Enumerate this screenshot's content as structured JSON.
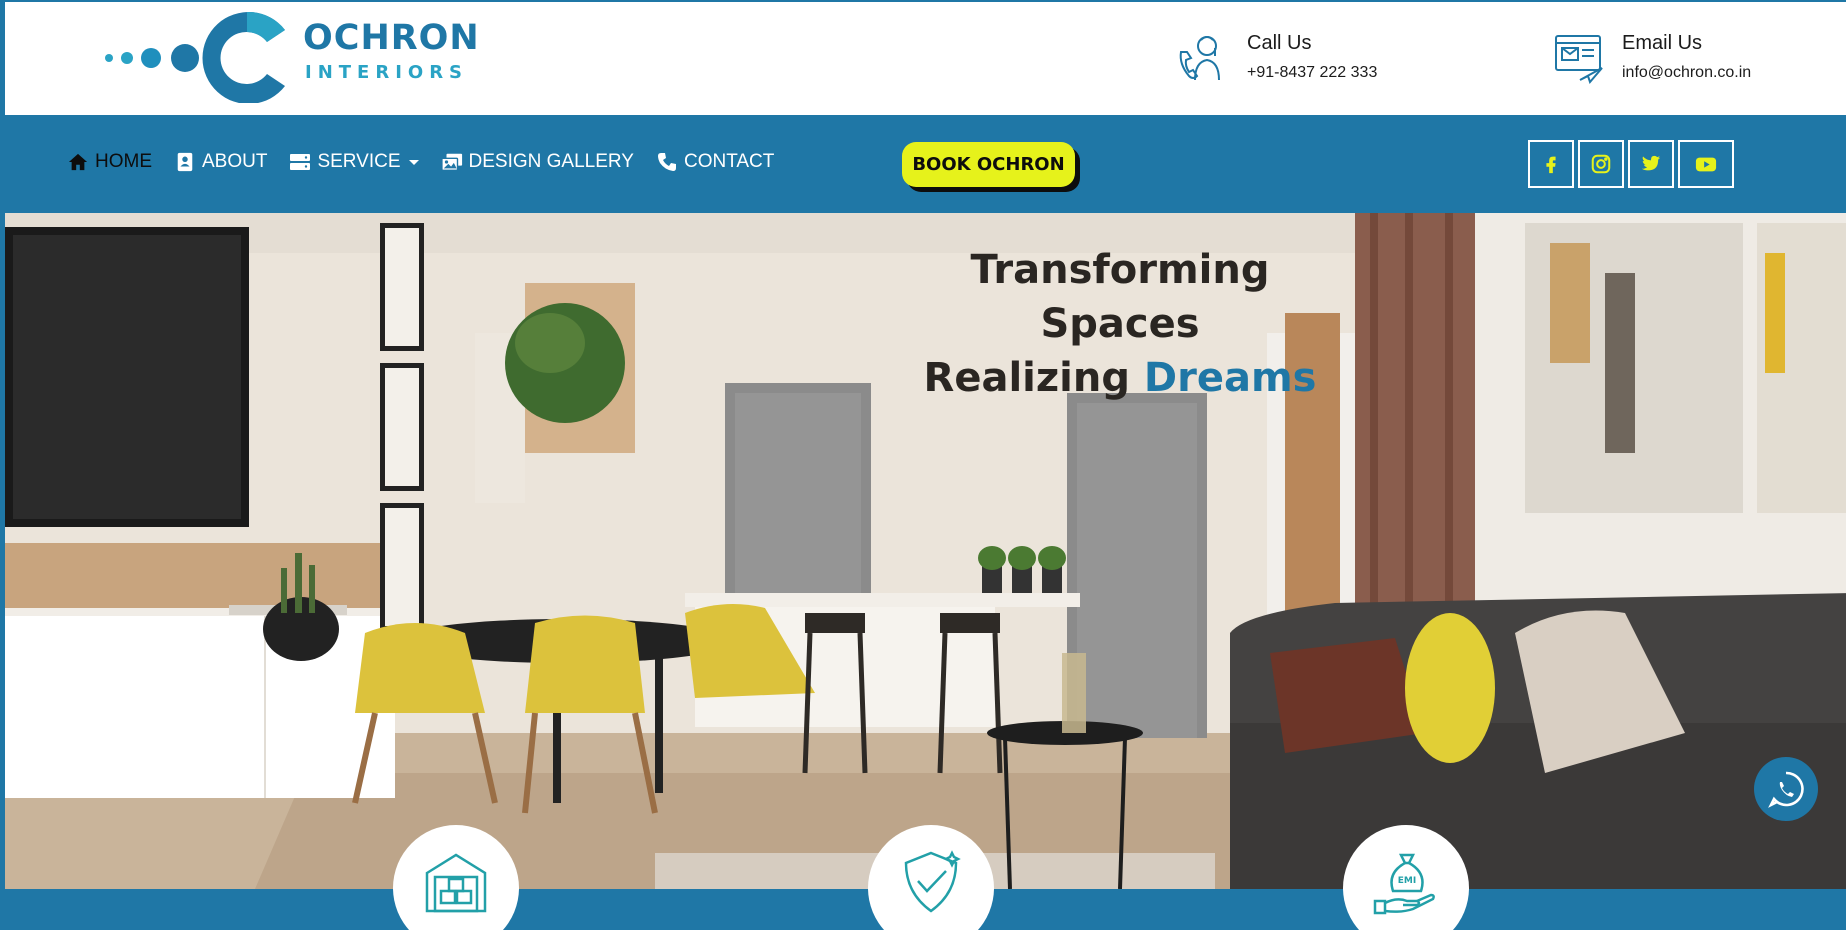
{
  "brand": {
    "name_line_1": "OCHRON",
    "name_line_2": "INTERIORS",
    "primary_color": "#1f77a6",
    "accent_color": "#e6f21b"
  },
  "header": {
    "call": {
      "title": "Call Us",
      "value": "+91-8437 222 333",
      "icon": "phone-support-icon"
    },
    "email": {
      "title": "Email Us",
      "value": "info@ochron.co.in",
      "icon": "email-icon"
    }
  },
  "nav": {
    "items": [
      {
        "label": "HOME",
        "icon": "home-icon",
        "active": true
      },
      {
        "label": "ABOUT",
        "icon": "contact-card-icon"
      },
      {
        "label": "SERVICE",
        "icon": "server-icon",
        "has_dropdown": true
      },
      {
        "label": "DESIGN GALLERY",
        "icon": "gallery-icon"
      },
      {
        "label": "CONTACT",
        "icon": "phone-icon"
      }
    ],
    "cta_label": "BOOK OCHRON",
    "social": [
      "facebook-icon",
      "instagram-icon",
      "twitter-icon",
      "youtube-icon"
    ]
  },
  "hero": {
    "title_line_1": "Transforming Spaces",
    "title_line_2_part_1": "Realizing ",
    "title_line_2_accent": "Dreams"
  },
  "features": [
    "warehouse-icon",
    "verified-shield-icon",
    "emi-icon"
  ],
  "floating": {
    "whatsapp_icon": "whatsapp-icon"
  }
}
